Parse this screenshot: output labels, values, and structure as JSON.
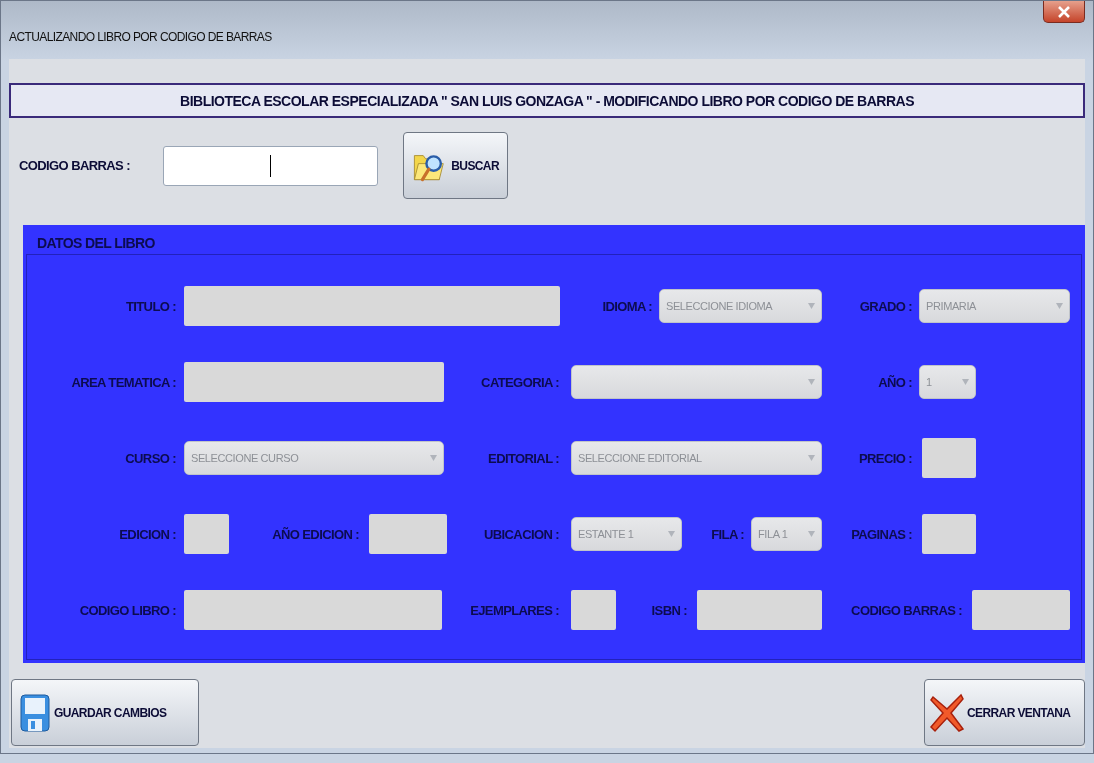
{
  "window": {
    "title": "ACTUALIZANDO LIBRO POR CODIGO DE BARRAS"
  },
  "header": "BIBLIOTECA ESCOLAR ESPECIALIZADA \" SAN LUIS GONZAGA \" - MODIFICANDO LIBRO POR CODIGO DE BARRAS",
  "search": {
    "label": "CODIGO BARRAS :",
    "disabled": false,
    "button": "BUSCAR"
  },
  "section": {
    "title": "DATOS DEL LIBRO",
    "fields": [
      {
        "label": "TITULO :",
        "kind": "text",
        "disabled": true
      },
      {
        "label": "IDIOMA :",
        "kind": "select",
        "value": "SELECCIONE IDIOMA",
        "disabled": true
      },
      {
        "label": "GRADO :",
        "kind": "select",
        "value": "PRIMARIA",
        "disabled": true
      },
      {
        "label": "AREA TEMATICA :",
        "kind": "text",
        "disabled": true
      },
      {
        "label": "CATEGORIA :",
        "kind": "select",
        "disabled": true
      },
      {
        "label": "AÑO :",
        "kind": "select",
        "value": "1",
        "disabled": true
      },
      {
        "label": "CURSO :",
        "kind": "select",
        "value": "SELECCIONE CURSO",
        "disabled": true
      },
      {
        "label": "EDITORIAL :",
        "kind": "select",
        "value": "SELECCIONE EDITORIAL",
        "disabled": true
      },
      {
        "label": "PRECIO :",
        "kind": "text",
        "disabled": true
      },
      {
        "label": "EDICION :",
        "kind": "text",
        "disabled": true
      },
      {
        "label": "AÑO EDICION :",
        "kind": "text",
        "disabled": true
      },
      {
        "label": "UBICACION :",
        "kind": "select",
        "value": "ESTANTE 1",
        "disabled": true
      },
      {
        "label": "FILA :",
        "kind": "select",
        "value": "FILA 1",
        "disabled": true
      },
      {
        "label": "PAGINAS :",
        "kind": "text",
        "disabled": true
      },
      {
        "label": "CODIGO LIBRO :",
        "kind": "text",
        "disabled": true
      },
      {
        "label": "EJEMPLARES :",
        "kind": "text",
        "disabled": true
      },
      {
        "label": "ISBN :",
        "kind": "text",
        "disabled": true
      },
      {
        "label": "CODIGO BARRAS :",
        "kind": "text",
        "disabled": true
      }
    ]
  },
  "buttons": [
    {
      "label": "GUARDAR CAMBIOS",
      "kind": "save"
    },
    {
      "label": "CERRAR VENTANA",
      "kind": "close"
    }
  ]
}
